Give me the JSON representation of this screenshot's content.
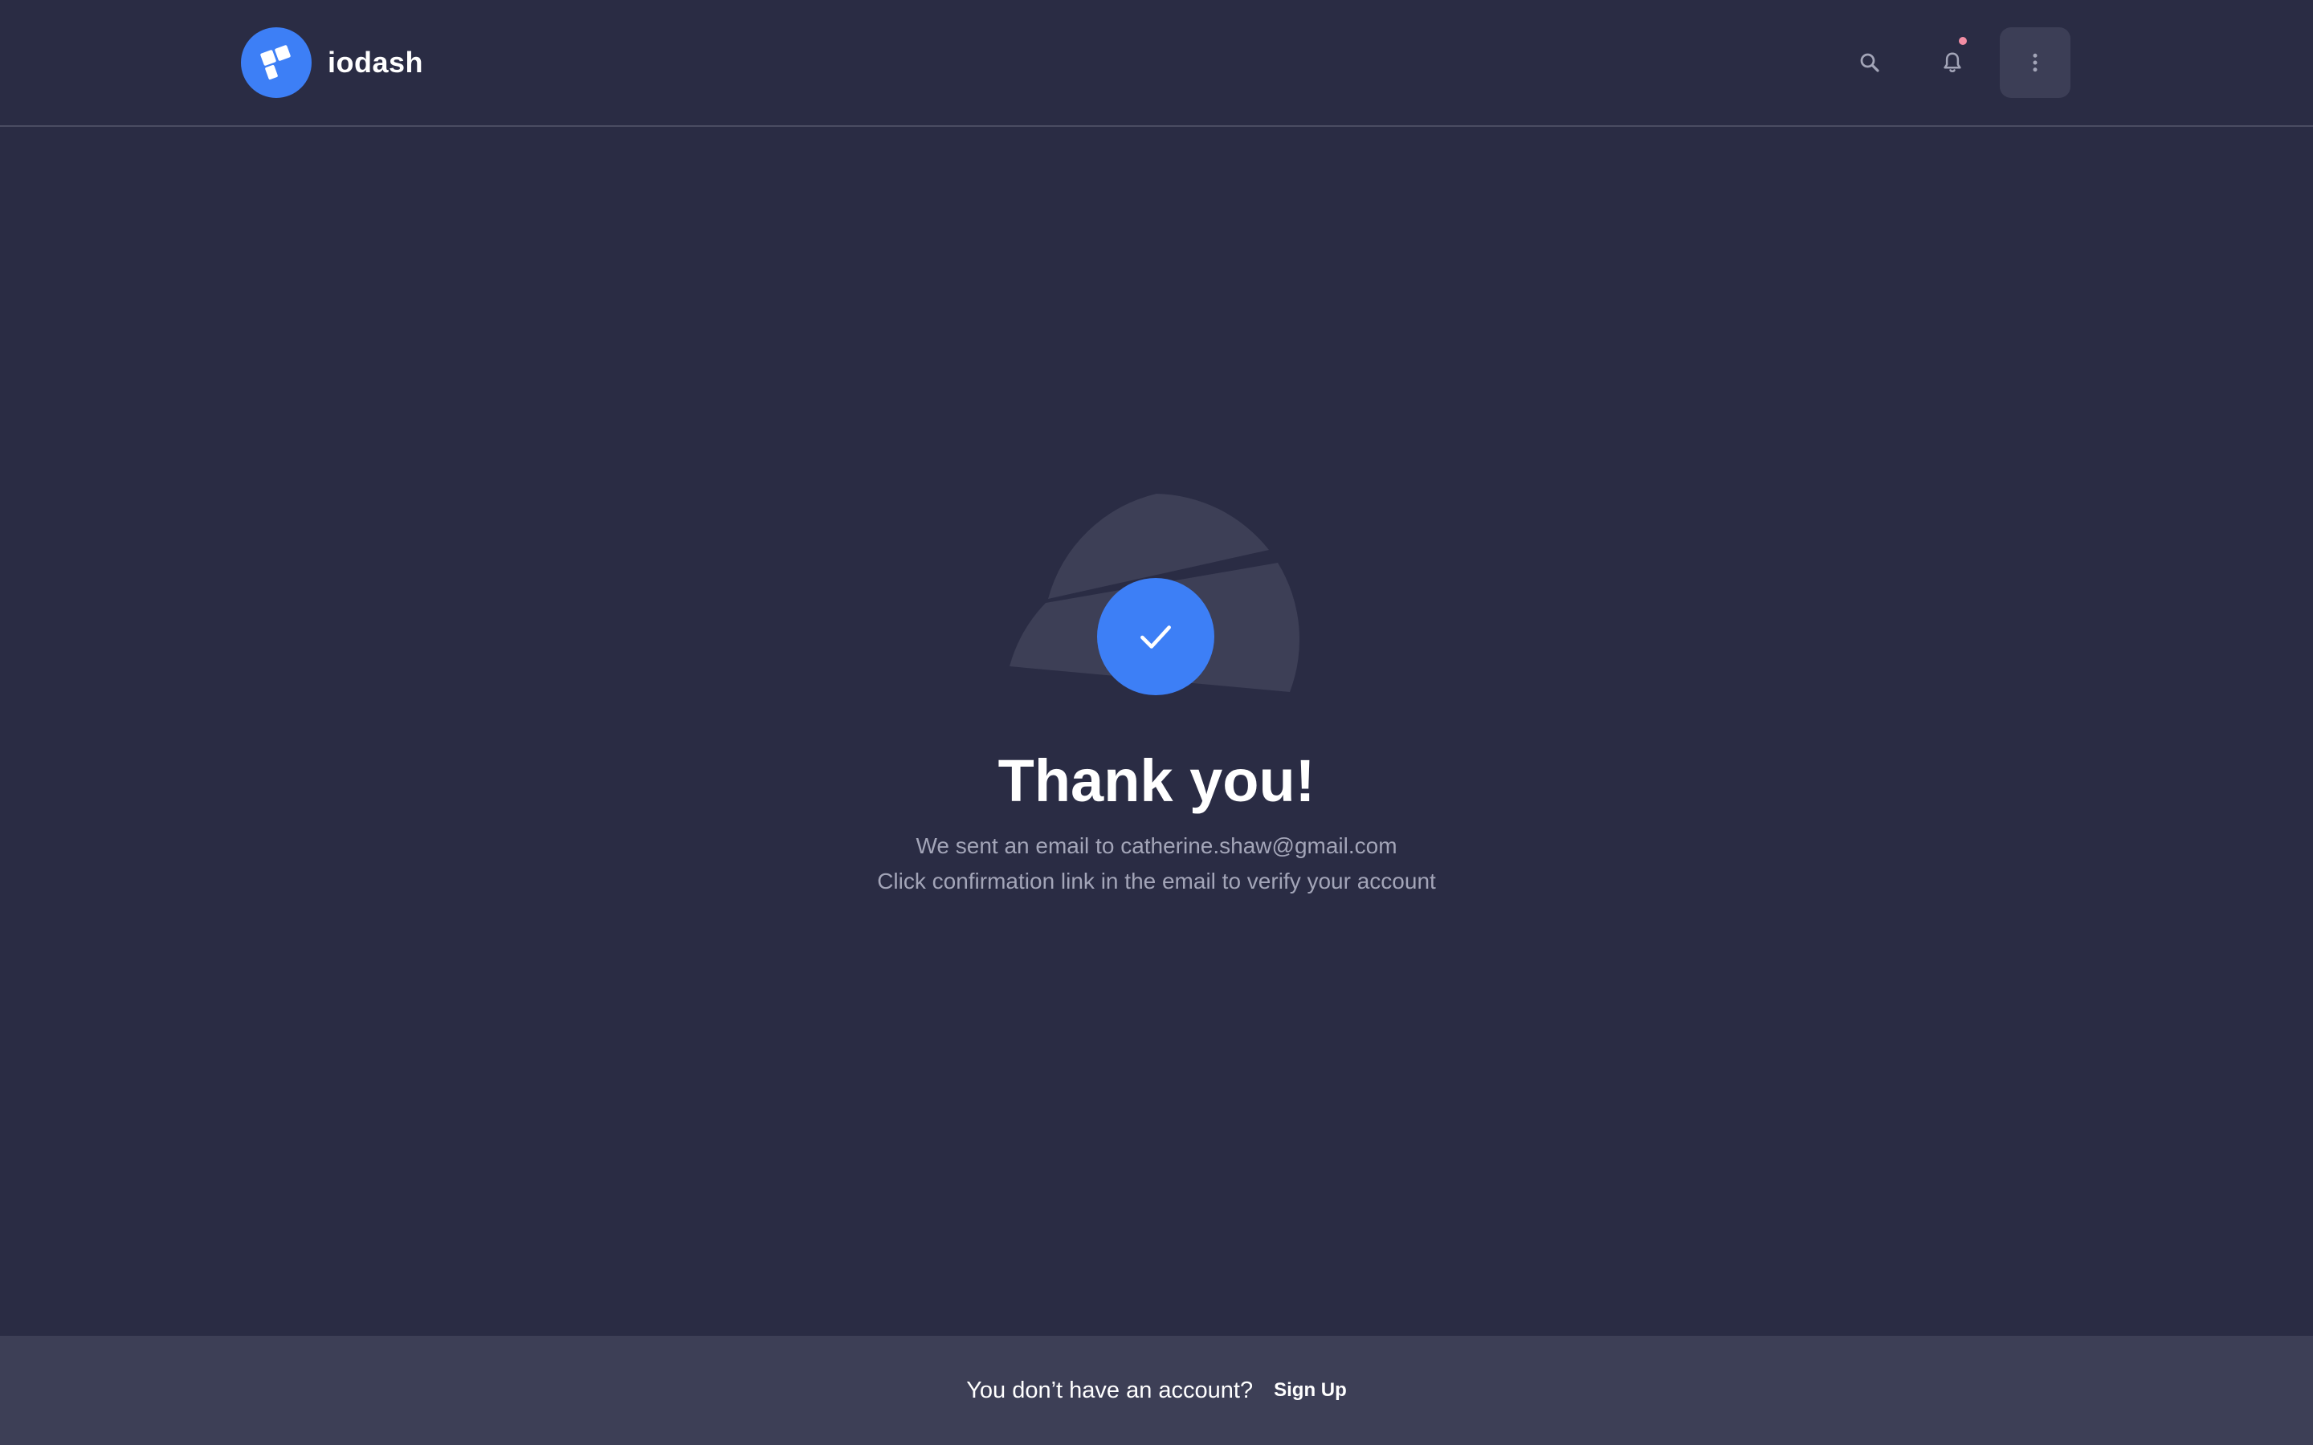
{
  "header": {
    "brand_name": "iodash",
    "icons": {
      "search": "search-icon",
      "notifications": "bell-icon",
      "menu": "more-vertical-icon"
    }
  },
  "main": {
    "title": "Thank you!",
    "line1": "We sent an email to catherine.shaw@gmail.com",
    "line2": "Click confirmation link in the email to verify your account"
  },
  "footer": {
    "prompt": "You don’t have an account?",
    "link_label": "Sign Up"
  },
  "colors": {
    "background": "#2a2c44",
    "accent": "#3d7ff6",
    "footer_bg": "#3d3f56",
    "notification_dot": "#f38ea4"
  }
}
